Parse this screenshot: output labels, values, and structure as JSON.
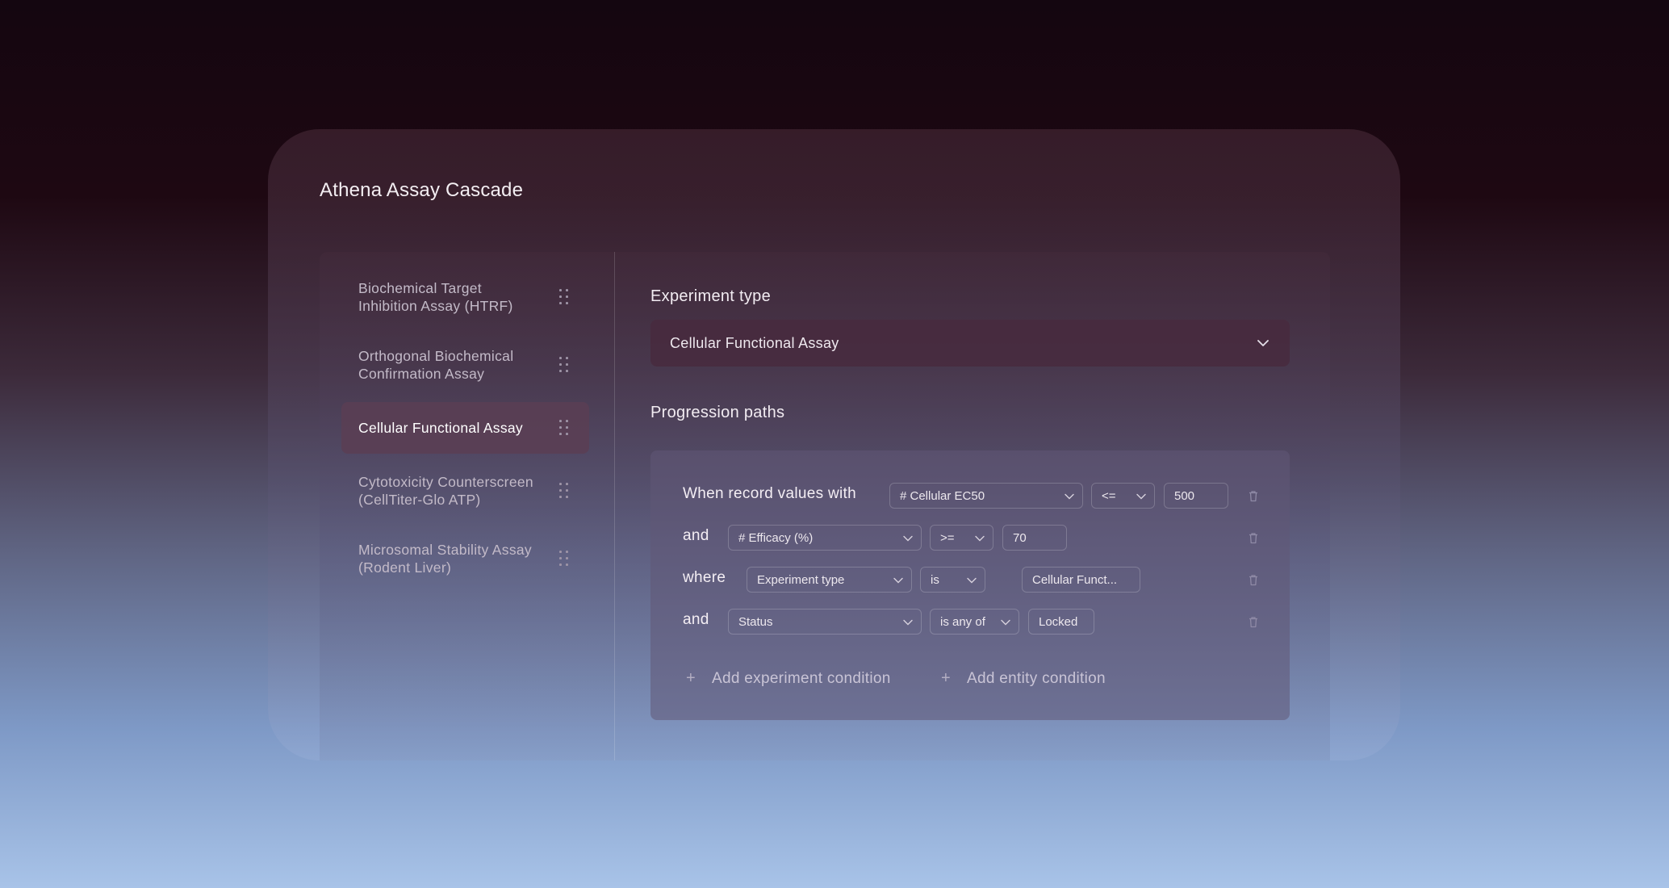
{
  "app": {
    "title": "Athena Assay Cascade"
  },
  "sidebar": {
    "items": [
      {
        "label": "Biochemical Target Inhibition Assay (HTRF)",
        "active": false
      },
      {
        "label": "Orthogonal Biochemical Confirmation Assay",
        "active": false
      },
      {
        "label": "Cellular Functional Assay",
        "active": true
      },
      {
        "label": "Cytotoxicity Counterscreen (CellTiter-Glo ATP)",
        "active": false
      },
      {
        "label": "Microsomal Stability Assay (Rodent Liver)",
        "active": false
      }
    ]
  },
  "main": {
    "experiment_type_label": "Experiment type",
    "experiment_type_value": "Cellular Functional Assay",
    "progression_label": "Progression paths",
    "conditions": [
      {
        "connector": "When record values with",
        "field": "# Cellular EC50",
        "operator": "<=",
        "value": "500",
        "value_is_dropdown": false
      },
      {
        "connector": "and",
        "field": "# Efficacy (%)",
        "operator": ">=",
        "value": "70",
        "value_is_dropdown": false
      },
      {
        "connector": "where",
        "field": "Experiment type",
        "operator": "is",
        "value": "Cellular Funct...",
        "value_is_dropdown": false
      },
      {
        "connector": "and",
        "field": "Status",
        "operator": "is any of",
        "value": "Locked",
        "value_is_dropdown": false
      }
    ],
    "add_experiment_condition": "Add experiment condition",
    "add_entity_condition": "Add entity condition"
  },
  "icons": {
    "drag": "drag-handle-icon",
    "chevron": "chevron-down-icon",
    "trash": "trash-icon",
    "plus": "plus-icon"
  },
  "colors": {
    "active_item_bg": "#5a3e54",
    "text_primary": "#f3eef2",
    "text_muted": "#c3bac8"
  }
}
